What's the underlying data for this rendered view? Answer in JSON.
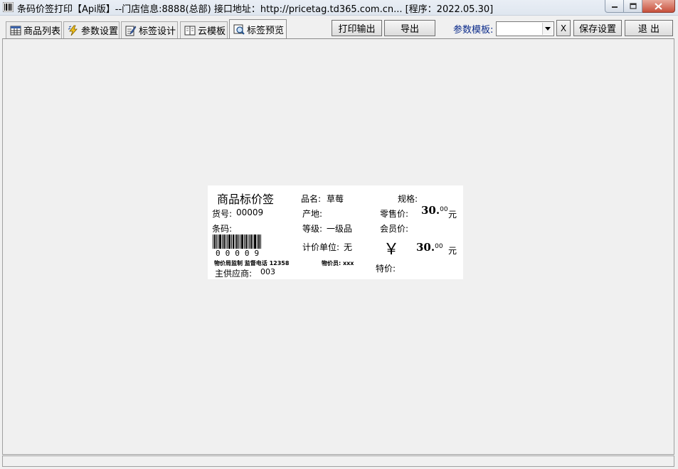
{
  "window": {
    "title": "条码价签打印【Api版】--门店信息:8888(总部) 接口地址：http://pricetag.td365.com.cn... [程序：2022.05.30]"
  },
  "tabs": [
    {
      "label": "商品列表",
      "icon": "table-icon"
    },
    {
      "label": "参数设置",
      "icon": "lightning-icon"
    },
    {
      "label": "标签设计",
      "icon": "edit-icon"
    },
    {
      "label": "云模板",
      "icon": "book-icon"
    },
    {
      "label": "标签预览",
      "icon": "preview-icon",
      "active": true
    }
  ],
  "toolbar": {
    "print_label": "打印输出",
    "export_label": "导出",
    "param_template_label": "参数模板:",
    "param_template_value": "",
    "clear_label": "X",
    "save_label": "保存设置",
    "exit_label": "退 出"
  },
  "price_label": {
    "title": "商品标价签",
    "name_label": "品名:",
    "name_value": "草莓",
    "spec_label": "规格:",
    "item_no_label": "货号:",
    "item_no_value": "00009",
    "origin_label": "产地:",
    "retail_price_label": "零售价:",
    "retail_price_int": "30.",
    "retail_price_dec": "00",
    "currency_unit": "元",
    "barcode_label": "条码:",
    "grade_label": "等级:",
    "grade_value": "一级品",
    "member_price_label": "会员价:",
    "unit_label": "计价单位:",
    "unit_value": "无",
    "yen_symbol": "￥",
    "member_price_int": "30.",
    "member_price_dec": "00",
    "barcode_number": "00009",
    "bureau_text": "物价局监制 监督电话 12358",
    "staff_text": "物价员: xxx",
    "supplier_label": "主供应商:",
    "supplier_value": "003",
    "special_price_label": "特价:"
  }
}
